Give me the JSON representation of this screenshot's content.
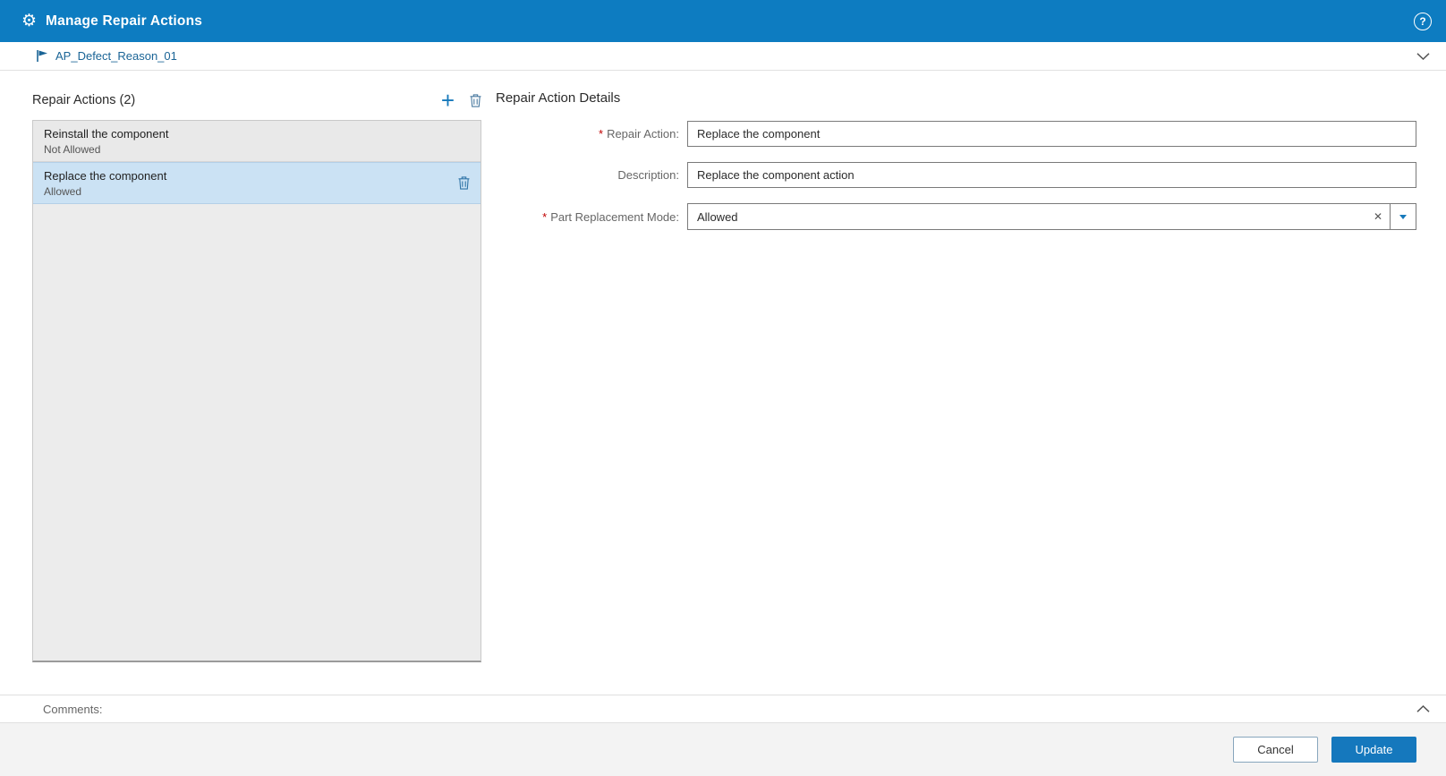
{
  "colors": {
    "header_bg": "#0d7cc1",
    "accent": "#1779bb",
    "selected_item_bg": "#cbe2f4",
    "required_red": "#c00000"
  },
  "header": {
    "title": "Manage Repair Actions"
  },
  "breadcrumb": {
    "label": "AP_Defect_Reason_01"
  },
  "left_panel": {
    "title": "Repair Actions (2)",
    "items": [
      {
        "name": "Reinstall the component",
        "mode": "Not Allowed",
        "selected": false
      },
      {
        "name": "Replace the component",
        "mode": "Allowed",
        "selected": true
      }
    ]
  },
  "details": {
    "title": "Repair Action Details",
    "fields": [
      {
        "label": "Repair Action:",
        "required": true,
        "value": "Replace the component",
        "type": "text"
      },
      {
        "label": "Description:",
        "required": false,
        "value": "Replace the component action",
        "type": "text"
      },
      {
        "label": "Part Replacement Mode:",
        "required": true,
        "value": "Allowed",
        "type": "combo"
      }
    ]
  },
  "comments": {
    "label": "Comments:"
  },
  "footer": {
    "cancel_label": "Cancel",
    "update_label": "Update"
  },
  "ui": {
    "required_marker": "*",
    "add_icon": "+",
    "clear_icon": "✕",
    "help_icon": "?",
    "gear_icon": "⚙"
  }
}
